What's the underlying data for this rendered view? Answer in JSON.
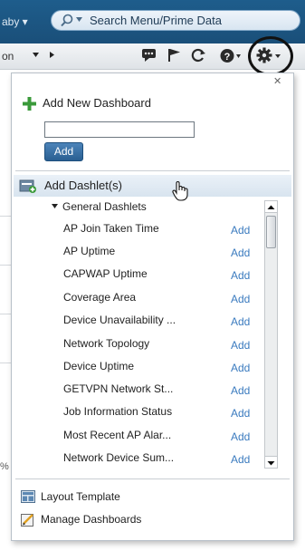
{
  "header": {
    "context_fragment": "aby ▾",
    "search": {
      "placeholder": "Search Menu/Prime Data"
    }
  },
  "toolbar": {
    "nav_fragment": "on",
    "icons": [
      "chat-icon",
      "flag-icon",
      "refresh-icon",
      "help-icon",
      "gear-icon"
    ]
  },
  "background": {
    "fragment": "%"
  },
  "dashboard_menu": {
    "add_new_dashboard": {
      "label": "Add New Dashboard",
      "name_value": "",
      "button_label": "Add"
    },
    "add_dashlets": {
      "label": "Add Dashlet(s)",
      "group_label": "General Dashlets",
      "items": [
        {
          "name": "AP Join Taken Time",
          "action": "Add"
        },
        {
          "name": "AP Uptime",
          "action": "Add"
        },
        {
          "name": "CAPWAP Uptime",
          "action": "Add"
        },
        {
          "name": "Coverage Area",
          "action": "Add"
        },
        {
          "name": "Device Unavailability ...",
          "action": "Add"
        },
        {
          "name": "Network Topology",
          "action": "Add"
        },
        {
          "name": "Device Uptime",
          "action": "Add"
        },
        {
          "name": "GETVPN Network St...",
          "action": "Add"
        },
        {
          "name": "Job Information Status",
          "action": "Add"
        },
        {
          "name": "Most Recent AP Alar...",
          "action": "Add"
        },
        {
          "name": "Network Device Sum...",
          "action": "Add"
        }
      ]
    },
    "footer": {
      "layout_template": "Layout Template",
      "manage_dashboards": "Manage Dashboards"
    }
  },
  "colors": {
    "header_blue": "#1e5d8c",
    "link_blue": "#3b7bbf",
    "button_blue": "#2a5f92",
    "add_plus_green": "#3a9a3a"
  }
}
